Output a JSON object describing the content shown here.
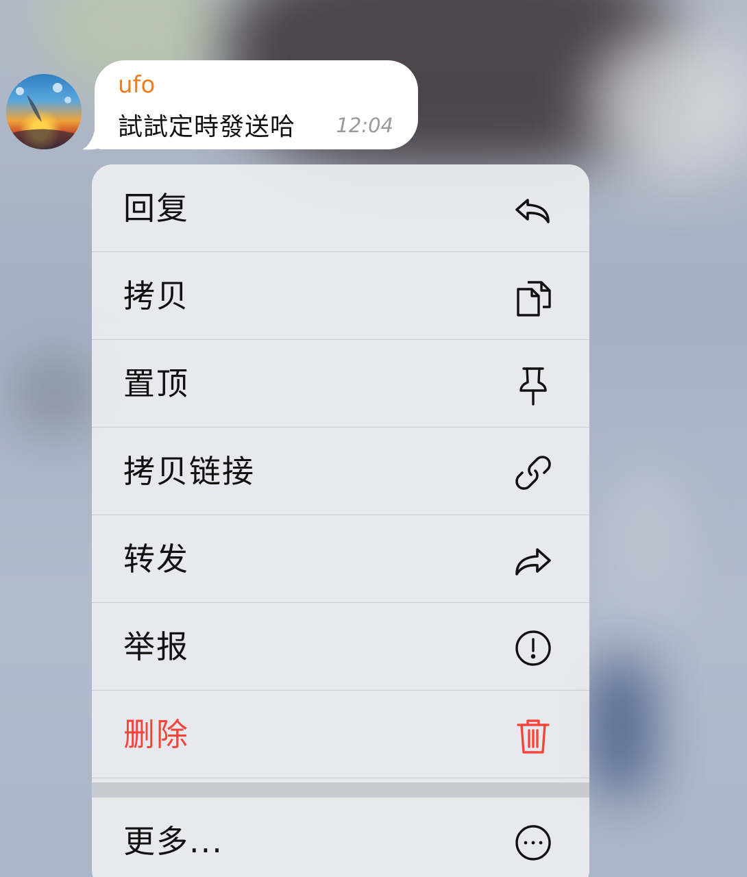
{
  "message": {
    "sender": "ufo",
    "text": "試試定時發送哈",
    "time": "12:04",
    "sender_color": "#ef7c1a"
  },
  "context_menu": {
    "items": [
      {
        "label": "回复",
        "icon": "reply-icon"
      },
      {
        "label": "拷贝",
        "icon": "copy-icon"
      },
      {
        "label": "置顶",
        "icon": "pin-icon"
      },
      {
        "label": "拷贝链接",
        "icon": "link-icon"
      },
      {
        "label": "转发",
        "icon": "forward-icon"
      },
      {
        "label": "举报",
        "icon": "report-icon"
      },
      {
        "label": "删除",
        "icon": "trash-icon",
        "destructive": true
      },
      {
        "label": "更多...",
        "icon": "more-icon"
      }
    ],
    "destructive_color": "#f2463d"
  }
}
